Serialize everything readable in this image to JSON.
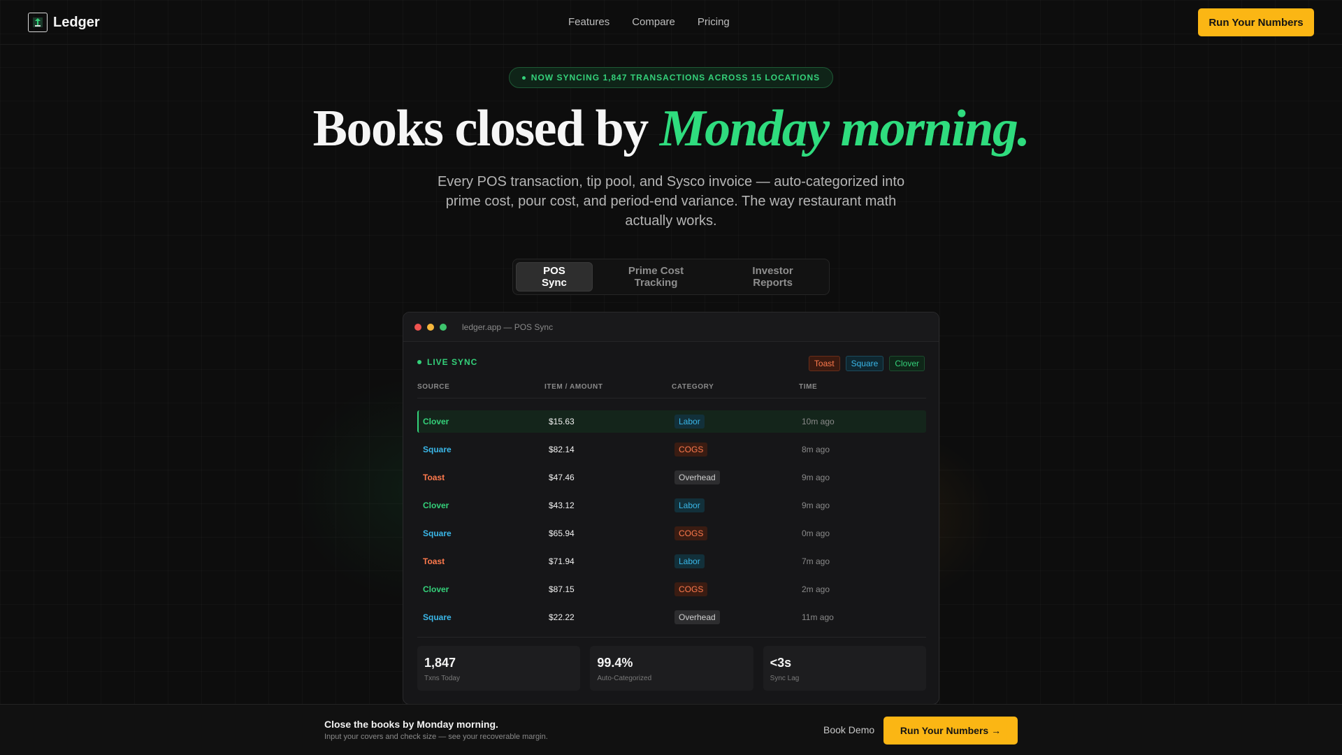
{
  "nav": {
    "brand": "Ledger",
    "logo_icon": "ledger-logo-icon",
    "links": [
      "Features",
      "Compare",
      "Pricing"
    ],
    "cta": "Run Your Numbers"
  },
  "hero": {
    "pill": "NOW SYNCING 1,847 TRANSACTIONS ACROSS 15 LOCATIONS",
    "title_plain": "Books closed by ",
    "title_accent": "Monday morning.",
    "subtitle": "Every POS transaction, tip pool, and Sysco invoice — auto-categorized into prime cost, pour cost, and period-end variance. The way restaurant math actually works."
  },
  "tabs": [
    {
      "label": "POS Sync",
      "active": true
    },
    {
      "label": "Prime Cost Tracking",
      "active": false
    },
    {
      "label": "Investor Reports",
      "active": false
    }
  ],
  "window": {
    "title": "ledger.app — POS Sync",
    "live_label": "LIVE SYNC",
    "badges": [
      "Toast",
      "Square",
      "Clover"
    ],
    "columns": [
      "SOURCE",
      "ITEM / AMOUNT",
      "CATEGORY",
      "TIME"
    ],
    "rows": [
      {
        "source": "Clover",
        "amount": "$15.63",
        "category": "Labor",
        "time": "10m ago"
      },
      {
        "source": "Square",
        "amount": "$82.14",
        "category": "COGS",
        "time": "8m ago"
      },
      {
        "source": "Toast",
        "amount": "$47.46",
        "category": "Overhead",
        "time": "9m ago"
      },
      {
        "source": "Clover",
        "amount": "$43.12",
        "category": "Labor",
        "time": "9m ago"
      },
      {
        "source": "Square",
        "amount": "$65.94",
        "category": "COGS",
        "time": "0m ago"
      },
      {
        "source": "Toast",
        "amount": "$71.94",
        "category": "Labor",
        "time": "7m ago"
      },
      {
        "source": "Clover",
        "amount": "$87.15",
        "category": "COGS",
        "time": "2m ago"
      },
      {
        "source": "Square",
        "amount": "$22.22",
        "category": "Overhead",
        "time": "11m ago"
      }
    ],
    "stats": [
      {
        "value": "1,847",
        "label": "Txns Today"
      },
      {
        "value": "99.4%",
        "label": "Auto-Categorized"
      },
      {
        "value": "<3s",
        "label": "Sync Lag"
      }
    ]
  },
  "bottom_bar": {
    "title": "Close the books by Monday morning.",
    "subtitle": "Input your covers and check size — see your recoverable margin.",
    "demo": "Book Demo",
    "cta": "Run Your Numbers →"
  },
  "colors": {
    "accent_green": "#2fdc7e",
    "cta_amber": "#fbb614",
    "toast": "#ff7a4d",
    "square": "#3ab7e8",
    "clover": "#34d17a"
  }
}
